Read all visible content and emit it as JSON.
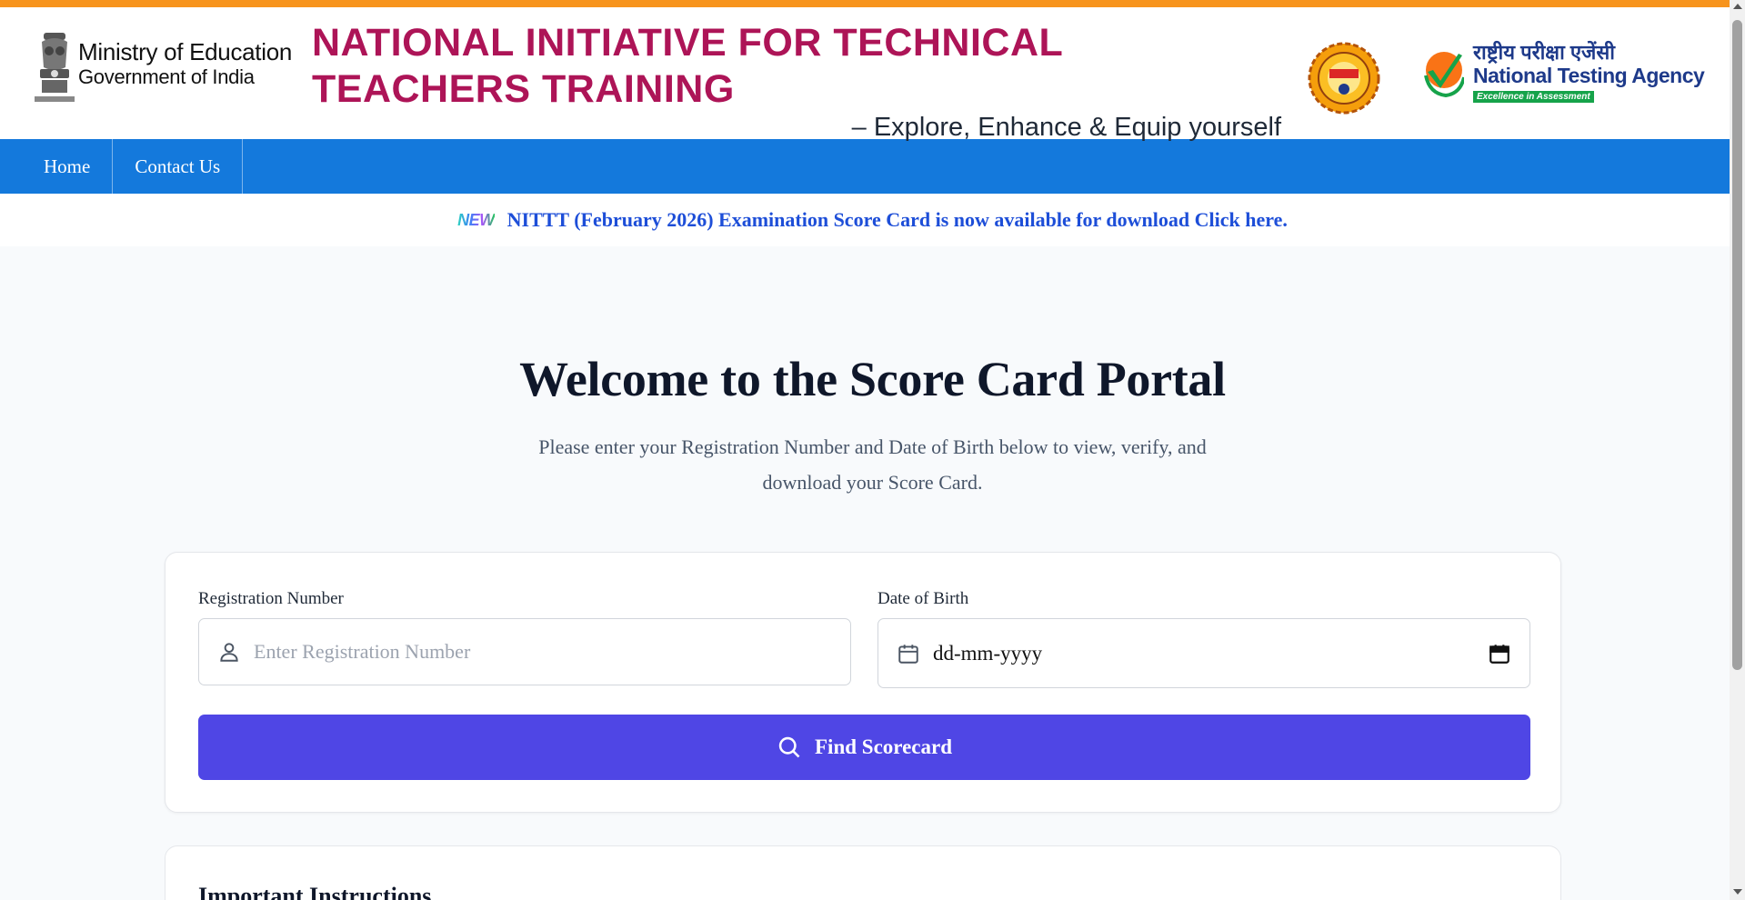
{
  "header": {
    "ministry_line1": "Ministry of Education",
    "ministry_line2": "Government of India",
    "title": "NATIONAL INITIATIVE FOR TECHNICAL TEACHERS TRAINING",
    "tagline": "– Explore, Enhance & Equip yourself",
    "nta_hindi": "राष्ट्रीय परीक्षा एजेंसी",
    "nta_english": "National Testing Agency",
    "nta_tagline": "Excellence in Assessment"
  },
  "nav": {
    "items": [
      {
        "label": "Home"
      },
      {
        "label": "Contact Us"
      }
    ]
  },
  "announcement": {
    "badge": "NEW",
    "text": "NITTT (February 2026) Examination Score Card is now available for download Click here."
  },
  "welcome": {
    "title": "Welcome to the Score Card Portal",
    "subtitle": "Please enter your Registration Number and Date of Birth below to view, verify, and download your Score Card."
  },
  "form": {
    "registration_label": "Registration Number",
    "registration_placeholder": "Enter Registration Number",
    "dob_label": "Date of Birth",
    "dob_value": "dd-mm-yyyy",
    "submit_label": "Find Scorecard"
  },
  "instructions": {
    "title": "Important Instructions"
  },
  "colors": {
    "top_bar": "#f7941d",
    "title": "#ad1457",
    "nav": "#1479dc",
    "announcement": "#1d4ed8",
    "button": "#4f46e5"
  }
}
